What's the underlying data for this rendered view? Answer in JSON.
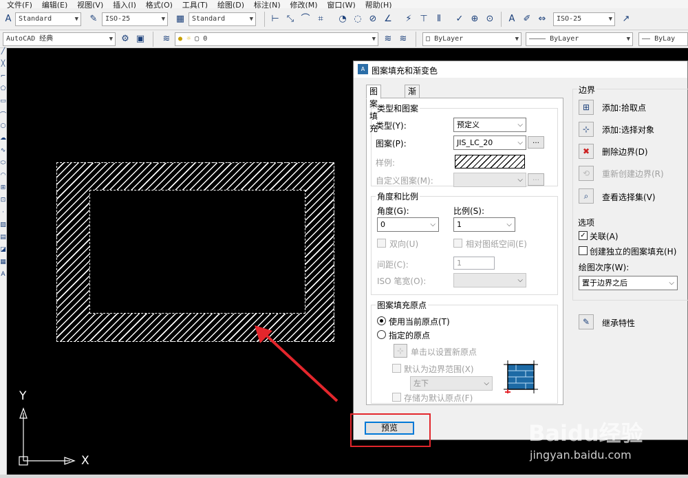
{
  "menubar": {
    "items": [
      "文件(F)",
      "编辑(E)",
      "视图(V)",
      "插入(I)",
      "格式(O)",
      "工具(T)",
      "绘图(D)",
      "标注(N)",
      "修改(M)",
      "窗口(W)",
      "帮助(H)"
    ]
  },
  "toolbar1": {
    "text_style": "Standard",
    "dim_style": "ISO-25",
    "table_style": "Standard",
    "mleader_style": "ISO-25"
  },
  "toolbar2": {
    "workspace": "AutoCAD 经典",
    "layer": "0",
    "color": "ByLayer",
    "linetype": "ByLayer",
    "lineweight": "ByLay"
  },
  "canvas": {
    "ucs_x": "X",
    "ucs_y": "Y"
  },
  "dialog": {
    "title": "图案填充和渐变色",
    "tabs": [
      "图案填充",
      "渐变色"
    ],
    "type_pattern": {
      "title": "类型和图案",
      "type_label": "类型(Y):",
      "type_value": "预定义",
      "pattern_label": "图案(P):",
      "pattern_value": "JIS_LC_20",
      "swatch_label": "样例:",
      "custom_label": "自定义图案(M):"
    },
    "angle_scale": {
      "title": "角度和比例",
      "angle_label": "角度(G):",
      "angle_value": "0",
      "scale_label": "比例(S):",
      "scale_value": "1",
      "double_label": "双向(U)",
      "relative_label": "相对图纸空间(E)",
      "spacing_label": "间距(C):",
      "spacing_value": "1",
      "iso_label": "ISO 笔宽(O):"
    },
    "origin": {
      "title": "图案填充原点",
      "current_label": "使用当前原点(T)",
      "specified_label": "指定的原点",
      "click_label": "单击以设置新原点",
      "default_extent_label": "默认为边界范围(X)",
      "extent_value": "左下",
      "store_label": "存储为默认原点(F)"
    },
    "boundary": {
      "title": "边界",
      "add_pick": "添加:拾取点",
      "add_select": "添加:选择对象",
      "remove": "删除边界(D)",
      "recreate": "重新创建边界(R)",
      "view_sel": "查看选择集(V)"
    },
    "options": {
      "title": "选项",
      "associative": "关联(A)",
      "associative_checked": true,
      "separate": "创建独立的图案填充(H)",
      "draw_order_label": "绘图次序(W):",
      "draw_order_value": "置于边界之后"
    },
    "inherit": "继承特性",
    "preview": "预览"
  },
  "watermark": {
    "brand": "Baidu经验",
    "url": "jingyan.baidu.com"
  },
  "colors": {
    "canvas": "#000000",
    "highlight": "#e3262c",
    "accent": "#0078d7"
  }
}
